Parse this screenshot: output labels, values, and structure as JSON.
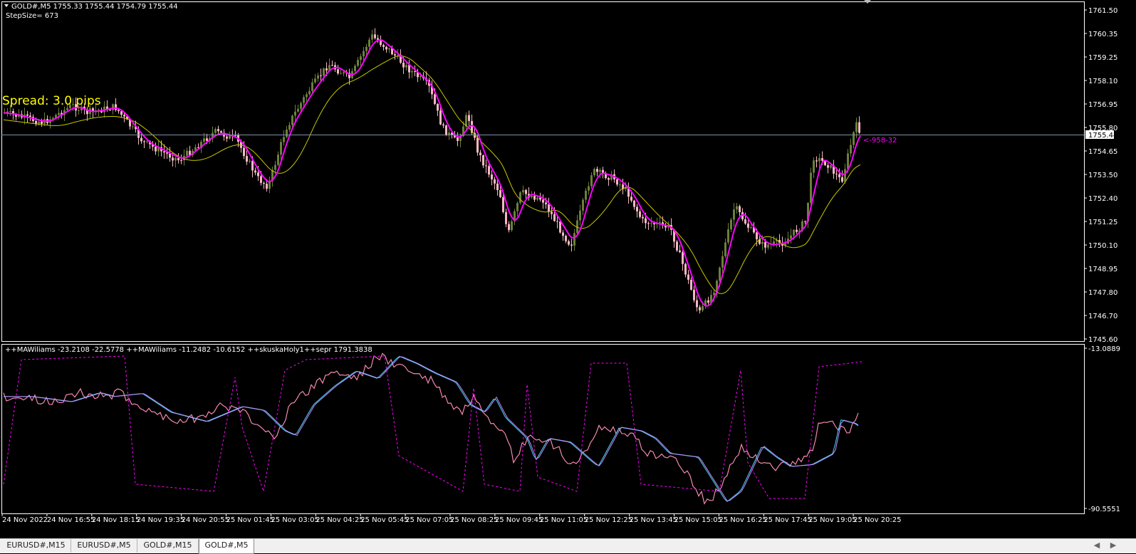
{
  "main_chart": {
    "header": "GOLD#,M5  1755.33 1755.44 1754.79 1755.44",
    "step_size": "StepSize= 673",
    "spread": "Spread: 3.0 pips",
    "price_labels": [
      "1761.50",
      "1760.35",
      "1759.25",
      "1758.10",
      "1756.95",
      "1755.80",
      "1754.65",
      "1753.50",
      "1752.40",
      "1751.25",
      "1750.10",
      "1748.95",
      "1747.80",
      "1746.70",
      "1745.60"
    ],
    "current_price": "1755.44",
    "annotation": "<-958-32",
    "colors": {
      "bull": "#6b7f3a",
      "bear": "#f4b8c2",
      "fast_ma": "#ff00ff",
      "slow_ma": "#c8c800",
      "price_line": "#7b8fa8",
      "spread": "#ffff00"
    }
  },
  "indicator": {
    "header": "++MAWiliams -23.2108 -22.5778   ++MAWiliams -11.2482 -10.6152   ++skuskaHoly1++sepr 1791.3838",
    "max_label": "-13.0889",
    "min_label": "-90.5551"
  },
  "time_axis": [
    "24 Nov 2022",
    "24 Nov 16:55",
    "24 Nov 18:15",
    "24 Nov 19:35",
    "24 Nov 20:55",
    "25 Nov 01:45",
    "25 Nov 03:05",
    "25 Nov 04:25",
    "25 Nov 05:45",
    "25 Nov 07:05",
    "25 Nov 08:25",
    "25 Nov 09:45",
    "25 Nov 11:05",
    "25 Nov 12:25",
    "25 Nov 13:45",
    "25 Nov 15:05",
    "25 Nov 16:25",
    "25 Nov 17:45",
    "25 Nov 19:05",
    "25 Nov 20:25"
  ],
  "tabs": [
    {
      "label": "EURUSD#,M15",
      "active": false
    },
    {
      "label": "EURUSD#,M5",
      "active": false
    },
    {
      "label": "GOLD#,M15",
      "active": false
    },
    {
      "label": "GOLD#,M5",
      "active": true
    }
  ],
  "scroll_left_icon": "chevron-left-icon",
  "scroll_right_icon": "chevron-right-icon"
}
